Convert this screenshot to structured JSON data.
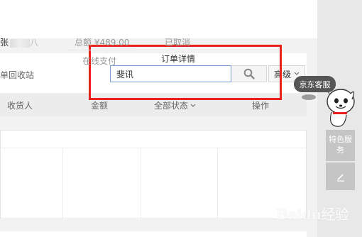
{
  "filter": {
    "order_recycle_label": "单回收站",
    "search_value": "斐讯",
    "advanced_label": "高级"
  },
  "table_header": {
    "recipient": "收货人",
    "amount": "金额",
    "status": "全部状态",
    "action": "操作"
  },
  "order": {
    "recipient_prefix": "张",
    "recipient_suffix": "八",
    "amount_text": "总额 ¥489.00",
    "payment_method": "在线支付",
    "status": "已取消",
    "detail_link": "订单详情"
  },
  "sidebar": {
    "customer_service": "京东客服",
    "feature_service": "特色服务"
  },
  "watermark": "Baidu经验",
  "colors": {
    "highlight": "#e8211f",
    "input_border": "#7b9fd4"
  }
}
